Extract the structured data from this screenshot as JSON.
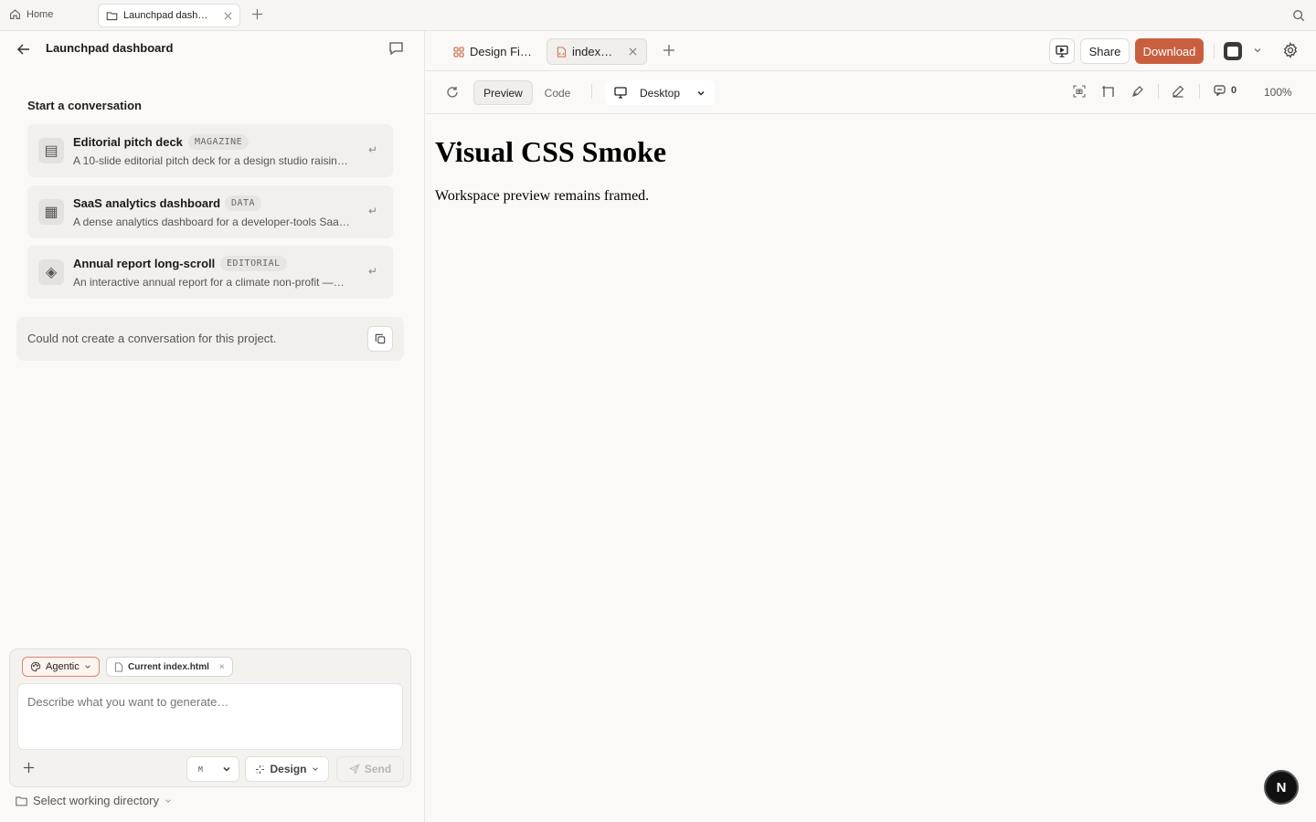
{
  "tabstrip": {
    "home_label": "Home",
    "doc_tab_title": "Launchpad dash…"
  },
  "sidebar": {
    "project_title": "Launchpad dashboard",
    "section_title": "Start a conversation",
    "templates": [
      {
        "name": "Saas",
        "title": "Editorial pitch deck",
        "tag": "MAGAZINE",
        "description": "A 10-slide editorial pitch deck for a design studio raisin…",
        "icon": "▤"
      },
      {
        "name": "data",
        "title": "SaaS analytics dashboard",
        "tag": "DATA",
        "description": "A dense analytics dashboard for a developer-tools Saa…",
        "icon": "▦"
      },
      {
        "name": "report",
        "title": "Annual report long-scroll",
        "tag": "EDITORIAL",
        "description": "An interactive annual report for a climate non-profit —…",
        "icon": "◈"
      }
    ],
    "return_glyph": "↵",
    "error_message": "Could not create a conversation for this project."
  },
  "composer": {
    "mode_label": "Agentic",
    "file_chip_label": "Current index.html",
    "file_chip_close": "×",
    "placeholder": "Describe what you want to generate…",
    "model_glyph": "M",
    "design_label": "Design",
    "send_label": "Send",
    "workdir_label": "Select working directory"
  },
  "workspace": {
    "tabs": [
      {
        "label": "Design Fi…",
        "active": false
      },
      {
        "label": "index…",
        "active": true
      }
    ],
    "share_label": "Share",
    "download_label": "Download",
    "toolbar": {
      "preview_label": "Preview",
      "code_label": "Code",
      "device_label": "Desktop",
      "comment_count": "0",
      "zoom_label": "100%"
    },
    "preview": {
      "heading": "Visual CSS Smoke",
      "paragraph": "Workspace preview remains framed."
    }
  },
  "badge_letter": "N",
  "colors": {
    "accent": "#c8603f",
    "background": "#faf9f7"
  }
}
